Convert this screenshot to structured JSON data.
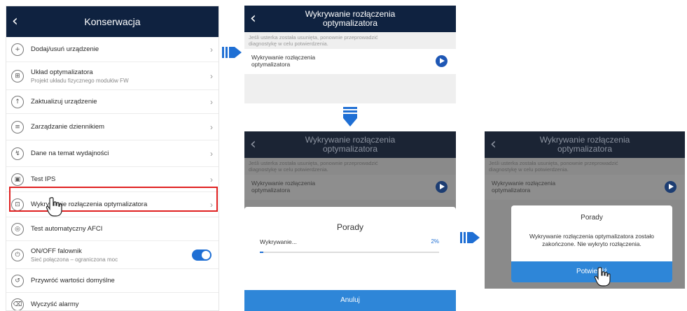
{
  "screen1": {
    "title": "Konserwacja",
    "items": [
      {
        "label": "Dodaj/usuń urządzenie",
        "icon": "plus-circle-icon",
        "glyph": "+"
      },
      {
        "label": "Układ optymalizatora",
        "sublabel": "Projekt układu fizycznego modułów FW",
        "icon": "optimizer-layout-icon",
        "glyph": "⊞"
      },
      {
        "label": "Zaktualizuj urządzenie",
        "icon": "upgrade-icon",
        "glyph": "↑"
      },
      {
        "label": "Zarządzanie dziennikiem",
        "icon": "log-icon",
        "glyph": "≡"
      },
      {
        "label": "Dane na temat wydajności",
        "icon": "performance-data-icon",
        "glyph": "↯"
      },
      {
        "label": "Test IPS",
        "icon": "ips-test-icon",
        "glyph": "▣"
      },
      {
        "label": "Wykrywanie rozłączenia optymalizatora",
        "icon": "optimizer-disconnect-icon",
        "glyph": "⊡"
      },
      {
        "label": "Test automatyczny AFCI",
        "icon": "afci-test-icon",
        "glyph": "◎"
      },
      {
        "label": "ON/OFF falownik",
        "sublabel": "Sieć połączona – ograniczona moc",
        "icon": "power-icon",
        "glyph": "⏻"
      },
      {
        "label": "Przywróć wartości domyślne",
        "icon": "restore-icon",
        "glyph": "↺"
      },
      {
        "label": "Wyczyść alarmy",
        "icon": "clear-alarm-icon",
        "glyph": "⌫"
      }
    ]
  },
  "detail": {
    "title_line1": "Wykrywanie rozłączenia",
    "title_line2": "optymalizatora",
    "hint_line1": "Jeśli usterka została usunięta, ponownie przeprowadzić",
    "hint_line2": "diagnostykę w celu potwierdzenia.",
    "item_line1": "Wykrywanie rozłączenia",
    "item_line2": "optymalizatora"
  },
  "progress_dialog": {
    "title": "Porady",
    "label": "Wykrywanie...",
    "percent_text": "2%",
    "progress": 0.02,
    "button": "Anuluj"
  },
  "result_dialog": {
    "title": "Porady",
    "message_line1": "Wykrywanie rozłączenia optymalizatora zostało",
    "message_line2": "zakończone. Nie wykryto rozłączenia.",
    "button": "Potwierdź"
  },
  "colors": {
    "header": "#0f2240",
    "accent": "#1f6fd4",
    "button": "#2e86d8",
    "highlight": "#e02020"
  }
}
